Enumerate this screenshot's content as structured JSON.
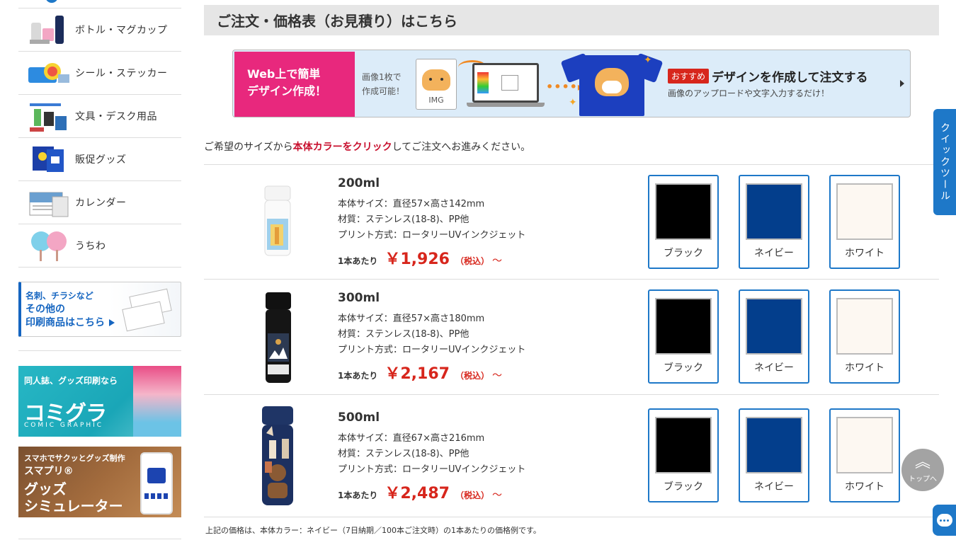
{
  "sidebar": {
    "items": [
      {
        "label": "ボトル・マグカップ",
        "icon": "bottle-mug-icon"
      },
      {
        "label": "シール・ステッカー",
        "icon": "sticker-icon"
      },
      {
        "label": "文具・デスク用品",
        "icon": "stationery-icon"
      },
      {
        "label": "販促グッズ",
        "icon": "promo-goods-icon"
      },
      {
        "label": "カレンダー",
        "icon": "calendar-icon"
      },
      {
        "label": "うちわ",
        "icon": "fan-icon"
      }
    ],
    "print_banner": {
      "line1": "名刺、チラシなど",
      "line2": "その他の",
      "line3": "印刷商品はこちら"
    },
    "comic_banner": {
      "line1": "同人誌、グッズ印刷なら",
      "logo": "コミグラ",
      "sub": "COMIC GRAPHIC"
    },
    "sim_banner": {
      "line1": "スマホでサクッとグッズ制作",
      "line2": "スマプリ®",
      "line3": "グッズ",
      "line4": "シミュレーター"
    }
  },
  "header": {
    "title": "ご注文・価格表（お見積り）はこちら"
  },
  "design_banner": {
    "pink_line1": "Web上で簡単",
    "pink_line2": "デザイン作成！",
    "small_line1": "画像1枚で",
    "small_line2": "作成可能！",
    "img_label": "IMG",
    "arrow_dots": "••••▸",
    "badge": "おすすめ",
    "title": "デザインを作成して注文する",
    "subtitle": "画像のアップロードや文字入力するだけ！"
  },
  "instruction": {
    "before": "ご希望のサイズから",
    "emphasis": "本体カラーをクリック",
    "after": "してご注文へお進みください。"
  },
  "colors": {
    "black": "#000000",
    "navy": "#033e8c",
    "white": "#fdf8f2",
    "accent": "#1e78c8",
    "price_red": "#d7261c"
  },
  "products": [
    {
      "capacity": "200ml",
      "size": "本体サイズ：直径57×高さ142mm",
      "material": "材質：ステンレス(18-8)、PP他",
      "print": "プリント方式：ロータリーUVインクジェット",
      "per_unit": "1本あたり",
      "price": "￥1,926",
      "tax": "（税込）",
      "tilde": "～",
      "swatches": [
        {
          "name": "ブラック",
          "color": "#000000"
        },
        {
          "name": "ネイビー",
          "color": "#033e8c"
        },
        {
          "name": "ホワイト",
          "color": "#fdf8f2"
        }
      ]
    },
    {
      "capacity": "300ml",
      "size": "本体サイズ：直径57×高さ180mm",
      "material": "材質：ステンレス(18-8)、PP他",
      "print": "プリント方式：ロータリーUVインクジェット",
      "per_unit": "1本あたり",
      "price": "￥2,167",
      "tax": "（税込）",
      "tilde": "～",
      "swatches": [
        {
          "name": "ブラック",
          "color": "#000000"
        },
        {
          "name": "ネイビー",
          "color": "#033e8c"
        },
        {
          "name": "ホワイト",
          "color": "#fdf8f2"
        }
      ]
    },
    {
      "capacity": "500ml",
      "size": "本体サイズ：直径67×高さ216mm",
      "material": "材質：ステンレス(18-8)、PP他",
      "print": "プリント方式：ロータリーUVインクジェット",
      "per_unit": "1本あたり",
      "price": "￥2,487",
      "tax": "（税込）",
      "tilde": "～",
      "swatches": [
        {
          "name": "ブラック",
          "color": "#000000"
        },
        {
          "name": "ネイビー",
          "color": "#033e8c"
        },
        {
          "name": "ホワイト",
          "color": "#fdf8f2"
        }
      ]
    }
  ],
  "footnote": "上記の価格は、本体カラー：ネイビー（7日納期／100本ご注文時）の1本あたりの価格例です。",
  "floating": {
    "quick_tool": "クイックツール",
    "to_top_glyph": "︽",
    "to_top_label": "トップへ"
  }
}
